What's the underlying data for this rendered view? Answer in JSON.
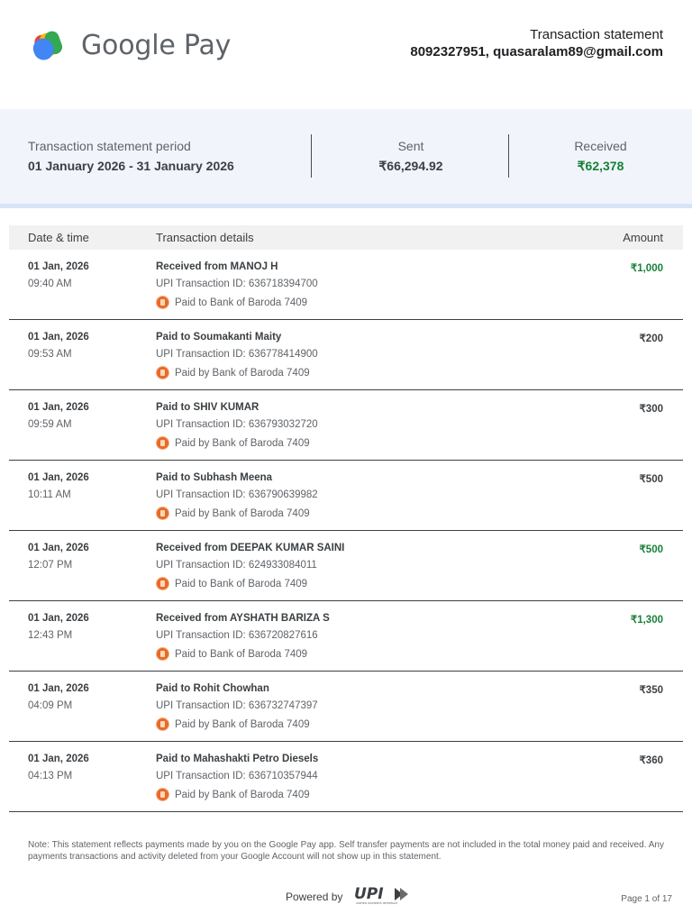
{
  "header": {
    "brand": "Google Pay",
    "doc_title": "Transaction statement",
    "contact": "8092327951, quasaralam89@gmail.com"
  },
  "summary": {
    "period_label": "Transaction statement period",
    "period_value": "01 January 2026 - 31 January 2026",
    "sent_label": "Sent",
    "sent_value": "₹66,294.92",
    "received_label": "Received",
    "received_value": "₹62,378"
  },
  "table": {
    "headers": [
      "Date & time",
      "Transaction details",
      "Amount"
    ],
    "rows": [
      {
        "date": "01 Jan, 2026",
        "time": "09:40 AM",
        "title": "Received from MANOJ H",
        "upi": "UPI Transaction ID: 636718394700",
        "bank": "Paid to Bank of Baroda 7409",
        "amount": "₹1,000",
        "credit": true
      },
      {
        "date": "01 Jan, 2026",
        "time": "09:53 AM",
        "title": "Paid to Soumakanti Maity",
        "upi": "UPI Transaction ID: 636778414900",
        "bank": "Paid by Bank of Baroda 7409",
        "amount": "₹200",
        "credit": false
      },
      {
        "date": "01 Jan, 2026",
        "time": "09:59 AM",
        "title": "Paid to SHIV KUMAR",
        "upi": "UPI Transaction ID: 636793032720",
        "bank": "Paid by Bank of Baroda 7409",
        "amount": "₹300",
        "credit": false
      },
      {
        "date": "01 Jan, 2026",
        "time": "10:11 AM",
        "title": "Paid to Subhash Meena",
        "upi": "UPI Transaction ID: 636790639982",
        "bank": "Paid by Bank of Baroda 7409",
        "amount": "₹500",
        "credit": false
      },
      {
        "date": "01 Jan, 2026",
        "time": "12:07 PM",
        "title": "Received from DEEPAK KUMAR SAINI",
        "upi": "UPI Transaction ID: 624933084011",
        "bank": "Paid to Bank of Baroda 7409",
        "amount": "₹500",
        "credit": true
      },
      {
        "date": "01 Jan, 2026",
        "time": "12:43 PM",
        "title": "Received from AYSHATH BARIZA S",
        "upi": "UPI Transaction ID: 636720827616",
        "bank": "Paid to Bank of Baroda 7409",
        "amount": "₹1,300",
        "credit": true
      },
      {
        "date": "01 Jan, 2026",
        "time": "04:09 PM",
        "title": "Paid to Rohit Chowhan",
        "upi": "UPI Transaction ID: 636732747397",
        "bank": "Paid by Bank of Baroda 7409",
        "amount": "₹350",
        "credit": false
      },
      {
        "date": "01 Jan, 2026",
        "time": "04:13 PM",
        "title": "Paid to Mahashakti Petro Diesels",
        "upi": "UPI Transaction ID: 636710357944",
        "bank": "Paid by Bank of Baroda 7409",
        "amount": "₹360",
        "credit": false
      }
    ]
  },
  "note": "Note: This statement reflects payments made by you on the Google Pay app. Self transfer payments are not included in the total money paid and received. Any payments transactions and activity deleted from your Google Account will not show up in this statement.",
  "footer": {
    "powered_by": "Powered by",
    "upi_logo": "UPI",
    "upi_tagline": "UNIFIED PAYMENTS INTERFACE",
    "page": "Page 1 of 17"
  },
  "colors": {
    "credit": "#188038",
    "summary_bg": "#f1f5fb",
    "summary_border": "#d6e4f7",
    "bank_icon": "#e8692a"
  },
  "icons": {
    "brand": "google-pay-logo",
    "bank": "bank-of-baroda-icon"
  }
}
